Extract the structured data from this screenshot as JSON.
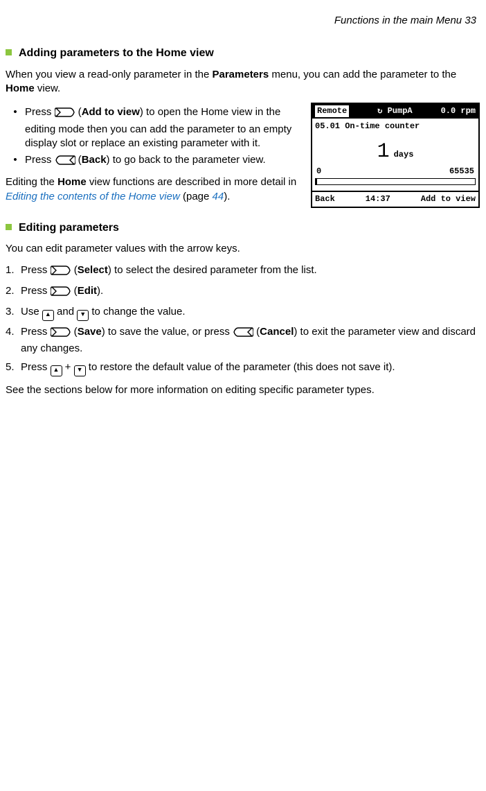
{
  "header": {
    "text": "Functions in the main Menu   33"
  },
  "section1": {
    "title": "Adding parameters to the Home view",
    "intro_pre": "When you view a read-only parameter in the ",
    "intro_param": "Parameters",
    "intro_mid": " menu, you can add the parameter to the ",
    "intro_home": "Home",
    "intro_post": " view.",
    "bullet1_a": "Press ",
    "bullet1_add": "Add to view",
    "bullet1_b": ") to open the Home view in the editing mode then you can add the parameter to an empty display slot or replace an existing parameter with it.",
    "bullet2_a": "Press ",
    "bullet2_back": "Back",
    "bullet2_b": ") to go back to the parameter view.",
    "outro_a": "Editing the ",
    "outro_home": "Home",
    "outro_b": " view functions are described in more detail in ",
    "outro_link": "Editing the contents of the Home view",
    "outro_c": " (page ",
    "outro_page": "44",
    "outro_d": ")."
  },
  "lcd": {
    "top_left": "Remote",
    "top_mid": "PumpA",
    "top_right": "0.0 rpm",
    "param": "05.01",
    "param_name": "On-time counter",
    "value": "1",
    "unit": "days",
    "min": "0",
    "max": "65535",
    "soft_left": "Back",
    "time": "14:37",
    "soft_right": "Add to view"
  },
  "section2": {
    "title": "Editing parameters",
    "intro": "You can edit parameter values with the arrow keys.",
    "step1_a": "Press ",
    "step1_sel": "Select",
    "step1_b": ") to select the desired parameter from the list.",
    "step2_a": "Press ",
    "step2_edit": "Edit",
    "step2_b": ").",
    "step3_a": "Use ",
    "step3_b": " and ",
    "step3_c": " to change the value.",
    "step4_a": "Press ",
    "step4_save": "Save",
    "step4_b": ") to save the value, or press ",
    "step4_cancel": "Cancel",
    "step4_c": ") to exit the parameter view and discard any changes.",
    "step5_a": "Press ",
    "step5_b": " + ",
    "step5_c": " to restore the default value of the parameter (this does not save it).",
    "outro": "See the sections below for more information on editing specific parameter types."
  },
  "nums": {
    "n1": "1.",
    "n2": "2.",
    "n3": "3.",
    "n4": "4.",
    "n5": "5."
  },
  "misc": {
    "bullet": "•",
    "open_paren": " ("
  }
}
